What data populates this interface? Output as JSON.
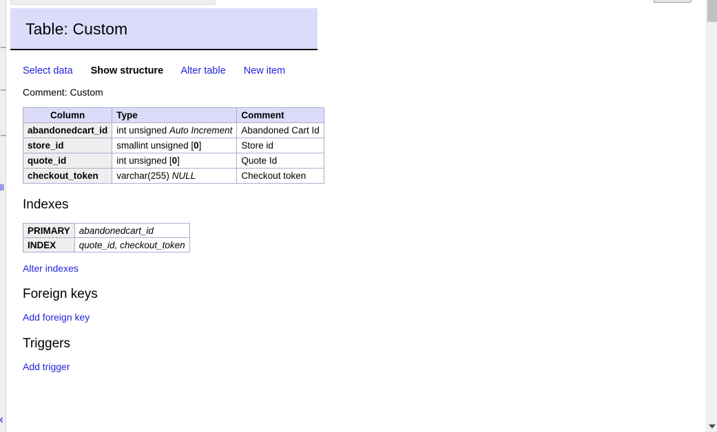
{
  "page": {
    "title": "Table: Custom",
    "comment_label": "Comment: Custom"
  },
  "nav": {
    "items": [
      {
        "label": "Select data",
        "active": false
      },
      {
        "label": "Show structure",
        "active": true
      },
      {
        "label": "Alter table",
        "active": false
      },
      {
        "label": "New item",
        "active": false
      }
    ]
  },
  "columns_table": {
    "headers": [
      "Column",
      "Type",
      "Comment"
    ],
    "rows": [
      {
        "column": "abandonedcart_id",
        "type_base": "int unsigned",
        "type_extra": "Auto Increment",
        "type_extra_style": "italic",
        "comment": "Abandoned Cart Id"
      },
      {
        "column": "store_id",
        "type_base": "smallint unsigned",
        "type_extra": "[0]",
        "type_extra_style": "default",
        "comment": "Store id"
      },
      {
        "column": "quote_id",
        "type_base": "int unsigned",
        "type_extra": "[0]",
        "type_extra_style": "default",
        "comment": "Quote Id"
      },
      {
        "column": "checkout_token",
        "type_base": "varchar(255)",
        "type_extra": "NULL",
        "type_extra_style": "italic",
        "comment": "Checkout token"
      }
    ]
  },
  "indexes": {
    "title": "Indexes",
    "rows": [
      {
        "type": "PRIMARY",
        "columns": "abandonedcart_id"
      },
      {
        "type": "INDEX",
        "columns": "quote_id, checkout_token"
      }
    ],
    "alter_link": "Alter indexes"
  },
  "foreign_keys": {
    "title": "Foreign keys",
    "add_link": "Add foreign key"
  },
  "triggers": {
    "title": "Triggers",
    "add_link": "Add trigger"
  },
  "colors": {
    "header_bg": "#dcdcfa",
    "link": "#2222dd",
    "table_border": "#aaaacc",
    "scrollbar_thumb": "#c1c1c1"
  }
}
